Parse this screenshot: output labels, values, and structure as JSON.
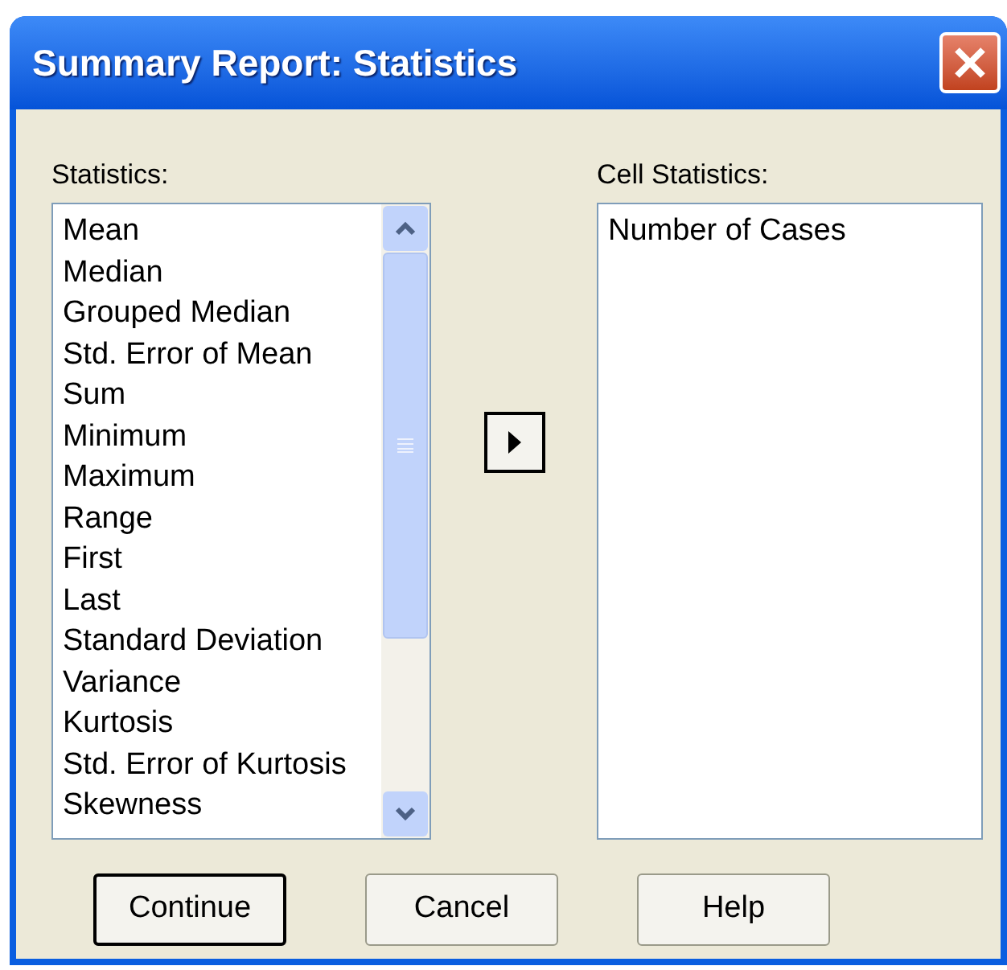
{
  "window": {
    "title": "Summary Report: Statistics"
  },
  "statistics": {
    "label": "Statistics:",
    "items": [
      "Mean",
      "Median",
      "Grouped Median",
      "Std. Error of Mean",
      "Sum",
      "Minimum",
      "Maximum",
      "Range",
      "First",
      "Last",
      "Standard Deviation",
      "Variance",
      "Kurtosis",
      "Std. Error of Kurtosis",
      "Skewness"
    ]
  },
  "cell_statistics": {
    "label": "Cell Statistics:",
    "items": [
      "Number of Cases"
    ]
  },
  "buttons": [
    {
      "label": "Continue",
      "default": true
    },
    {
      "label": "Cancel",
      "default": false
    },
    {
      "label": "Help",
      "default": false
    }
  ]
}
